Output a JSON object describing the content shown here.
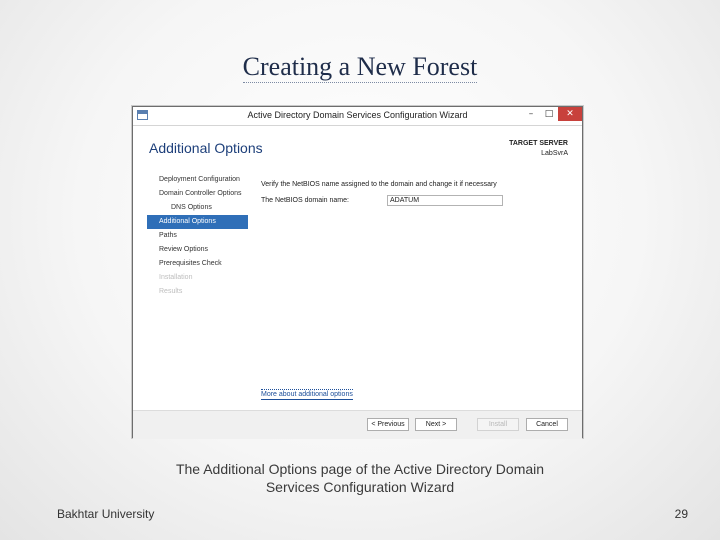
{
  "slide": {
    "title": "Creating a New Forest",
    "caption_line1": "The Additional Options page of the Active Directory Domain",
    "caption_line2": "Services Configuration Wizard",
    "footer_left": "Bakhtar University",
    "page_number": "29"
  },
  "wizard": {
    "window_title": "Active Directory Domain Services Configuration Wizard",
    "window_buttons": {
      "minimize": "–",
      "maximize": "□",
      "close": "✕"
    },
    "page_heading": "Additional Options",
    "target_server_label": "TARGET SERVER",
    "target_server_name": "LabSvrA",
    "nav": [
      {
        "label": "Deployment Configuration",
        "state": "normal"
      },
      {
        "label": "Domain Controller Options",
        "state": "normal"
      },
      {
        "label": "DNS Options",
        "state": "sub"
      },
      {
        "label": "Additional Options",
        "state": "active"
      },
      {
        "label": "Paths",
        "state": "normal"
      },
      {
        "label": "Review Options",
        "state": "normal"
      },
      {
        "label": "Prerequisites Check",
        "state": "normal"
      },
      {
        "label": "Installation",
        "state": "disabled"
      },
      {
        "label": "Results",
        "state": "disabled"
      }
    ],
    "verify_text": "Verify the NetBIOS name assigned to the domain and change it if necessary",
    "netbios_label": "The NetBIOS domain name:",
    "netbios_value": "ADATUM",
    "more_link": "More about additional options",
    "buttons": {
      "previous": "< Previous",
      "next": "Next >",
      "install": "Install",
      "cancel": "Cancel"
    },
    "colors": {
      "accent": "#2f6fb8",
      "heading": "#1d3f7a",
      "close": "#c8413c"
    }
  }
}
